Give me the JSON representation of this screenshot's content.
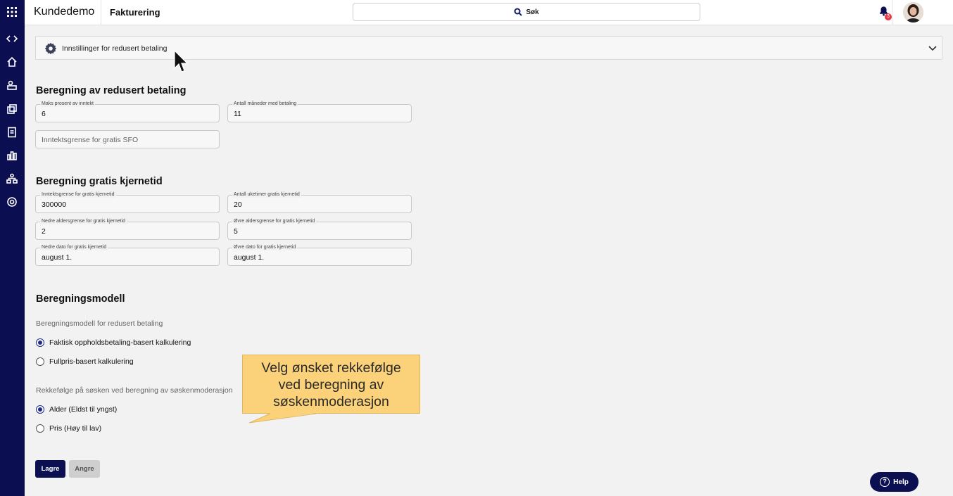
{
  "topbar": {
    "brand": "Kundedemo",
    "module": "Fakturering",
    "search_label": "Søk",
    "notification_count": "3"
  },
  "sidebar": {
    "icons": [
      "grid-icon",
      "code-icon",
      "home-icon",
      "users-icon",
      "coins-icon",
      "document-icon",
      "chart-icon",
      "org-icon",
      "settings-icon"
    ]
  },
  "settings_panel": {
    "label": "Innstillinger for redusert betaling"
  },
  "section_reduced": {
    "title": "Beregning av redusert betaling",
    "max_percent_label": "Maks prosent av inntekt",
    "max_percent_value": "6",
    "months_label": "Antall måneder med betaling",
    "months_value": "11",
    "sfo_placeholder": "Inntektsgrense for gratis SFO"
  },
  "section_free": {
    "title": "Beregning gratis kjernetid",
    "income_limit_label": "Inntektsgrense for gratis kjernetid",
    "income_limit_value": "300000",
    "weekly_hours_label": "Antall uketimer gratis kjernetid",
    "weekly_hours_value": "20",
    "lower_age_label": "Nedre aldersgrense for gratis kjernetid",
    "lower_age_value": "2",
    "upper_age_label": "Øvre aldersgrense for gratis kjernetid",
    "upper_age_value": "5",
    "lower_date_label": "Nedre dato for gratis kjernetid",
    "lower_date_value": "august 1.",
    "upper_date_label": "Øvre dato for gratis kjernetid",
    "upper_date_value": "august 1."
  },
  "section_model": {
    "title": "Beregningsmodell",
    "model_label": "Beregningsmodell for redusert betaling",
    "model_options": [
      "Faktisk oppholdsbetaling-basert kalkulering",
      "Fullpris-basert kalkulering"
    ],
    "model_selected": 0,
    "order_label": "Rekkefølge på søsken ved beregning av søskenmoderasjon",
    "order_options": [
      "Alder (Eldst til yngst)",
      "Pris (Høy til lav)"
    ],
    "order_selected": 0
  },
  "callout": {
    "line1": "Velg ønsket rekkefølge",
    "line2": "ved beregning av",
    "line3": "søskenmoderasjon"
  },
  "actions": {
    "save": "Lagre",
    "cancel": "Angre",
    "help": "Help"
  },
  "colors": {
    "brand_navy": "#0b0f52",
    "callout": "#fbd27a",
    "badge": "#e63946"
  }
}
